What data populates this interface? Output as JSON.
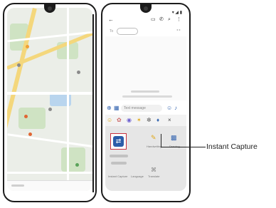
{
  "callout": {
    "label": "Instant Capture"
  },
  "messaging": {
    "compose_placeholder": "Text message",
    "timestamp": "Yesterday 11:08 am",
    "conversation_note": "Conversation with 010-0000-0000",
    "status": "▾ ◢ ▮"
  },
  "keyboard_panel": {
    "tile_label": "Instant Capture",
    "handwriting_label": "Handwriting",
    "drawing_label": "Drawing",
    "translate_label": "Translate",
    "language_label": "Language"
  }
}
